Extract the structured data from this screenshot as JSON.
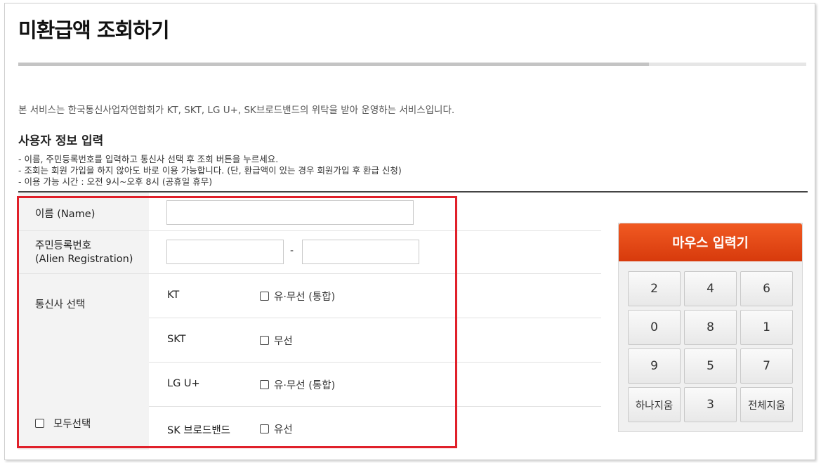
{
  "page": {
    "title": "미환급액 조회하기",
    "progress_fraction": 0.8,
    "intro": "본 서비스는 한국통신사업자연합회가 KT, SKT, LG U+, SK브로드밴드의 위탁을 받아 운영하는 서비스입니다.",
    "section_title": "사용자 정보 입력",
    "notes": [
      "- 이름, 주민등록번호를 입력하고 통신사 선택 후 조회 버튼을 누르세요.",
      "- 조회는 회원 가입을 하지 않아도 바로 이용 가능합니다. (단, 환급액이 있는 경우 회원가입 후 환급 신청)",
      "- 이용 가능 시간 : 오전 9시~오후 8시 (공휴일 휴무)"
    ]
  },
  "form": {
    "name_label": "이름 (Name)",
    "name_value": "",
    "rrn_label_line1": "주민등록번호",
    "rrn_label_line2": "(Alien Registration)",
    "rrn_front_value": "",
    "rrn_back_value": "",
    "rrn_separator": "-",
    "carrier_label": "통신사 선택",
    "select_all_label": "모두선택",
    "carriers": [
      {
        "name": "KT",
        "option": "유·무선 (통합)"
      },
      {
        "name": "SKT",
        "option": "무선"
      },
      {
        "name": "LG U+",
        "option": "유·무선 (통합)"
      },
      {
        "name": "SK 브로드밴드",
        "option": "유선"
      }
    ]
  },
  "keypad": {
    "title": "마우스 입력기",
    "keys": [
      "2",
      "4",
      "6",
      "0",
      "8",
      "1",
      "9",
      "5",
      "7",
      "하나지움",
      "3",
      "전체지움"
    ]
  },
  "colors": {
    "highlight_border": "#e0202a",
    "keypad_header": "#e34a16"
  }
}
